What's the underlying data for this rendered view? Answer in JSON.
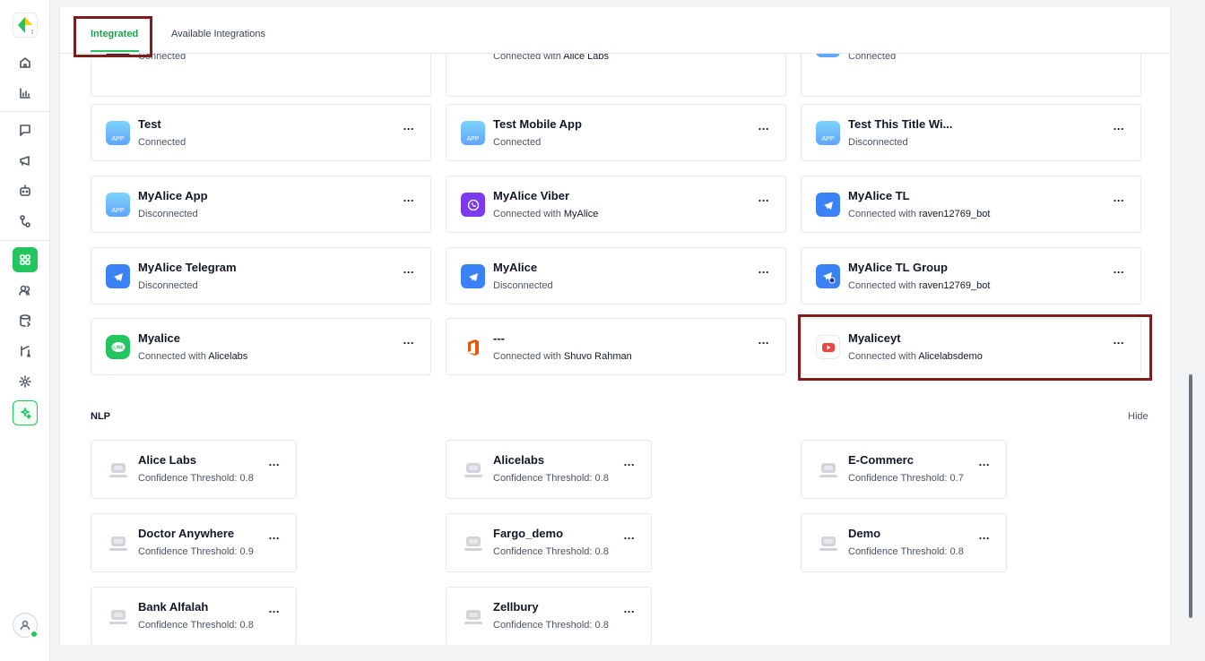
{
  "tabs": {
    "integrated": "Integrated",
    "available": "Available Integrations"
  },
  "integrations": [
    {
      "title": "",
      "status": "Connected",
      "with": "",
      "icon": "chat-icon"
    },
    {
      "title": "",
      "status": "Connected with ",
      "with": "Alice Labs",
      "icon": "google-icon"
    },
    {
      "title": "",
      "status": "Connected",
      "with": "",
      "icon": "app-icon"
    },
    {
      "title": "Test",
      "status": "Connected",
      "with": "",
      "icon": "app-icon"
    },
    {
      "title": "Test Mobile App",
      "status": "Connected",
      "with": "",
      "icon": "app-icon"
    },
    {
      "title": "Test This Title Wi...",
      "status": "Disconnected",
      "with": "",
      "icon": "app-icon"
    },
    {
      "title": "MyAlice App",
      "status": "Disconnected",
      "with": "",
      "icon": "app-icon"
    },
    {
      "title": "MyAlice Viber",
      "status": "Connected with ",
      "with": "MyAlice",
      "icon": "viber-icon"
    },
    {
      "title": "MyAlice TL",
      "status": "Connected with ",
      "with": "raven12769_bot",
      "icon": "telegram-icon"
    },
    {
      "title": "MyAlice Telegram",
      "status": "Disconnected",
      "with": "",
      "icon": "telegram-icon"
    },
    {
      "title": "MyAlice",
      "status": "Disconnected",
      "with": "",
      "icon": "telegram-icon"
    },
    {
      "title": "MyAlice TL Group",
      "status": "Connected with ",
      "with": "raven12769_bot",
      "icon": "telegram-group-icon"
    },
    {
      "title": "Myalice",
      "status": "Connected with ",
      "with": "Alicelabs",
      "icon": "line-icon"
    },
    {
      "title": "---",
      "status": "Connected with ",
      "with": "Shuvo Rahman",
      "icon": "office-icon"
    },
    {
      "title": "Myaliceyt",
      "status": "Connected with ",
      "with": "Alicelabsdemo",
      "icon": "youtube-icon"
    }
  ],
  "app_badge": "APP",
  "more_label": "...",
  "nlp": {
    "label": "NLP",
    "hide": "Hide",
    "items": [
      {
        "title": "Alice Labs",
        "threshold": "Confidence Threshold: 0.8"
      },
      {
        "title": "Alicelabs",
        "threshold": "Confidence Threshold: 0.8"
      },
      {
        "title": "E-Commerc",
        "threshold": "Confidence Threshold: 0.7"
      },
      {
        "title": "Doctor Anywhere",
        "threshold": "Confidence Threshold: 0.9"
      },
      {
        "title": "Fargo_demo",
        "threshold": "Confidence Threshold: 0.8"
      },
      {
        "title": "Demo",
        "threshold": "Confidence Threshold: 0.8"
      },
      {
        "title": "Bank Alfalah",
        "threshold": "Confidence Threshold: 0.8"
      },
      {
        "title": "Zellbury",
        "threshold": "Confidence Threshold: 0.8"
      }
    ]
  },
  "colors": {
    "accent": "#22c55e",
    "highlight": "#7f1d1d"
  }
}
